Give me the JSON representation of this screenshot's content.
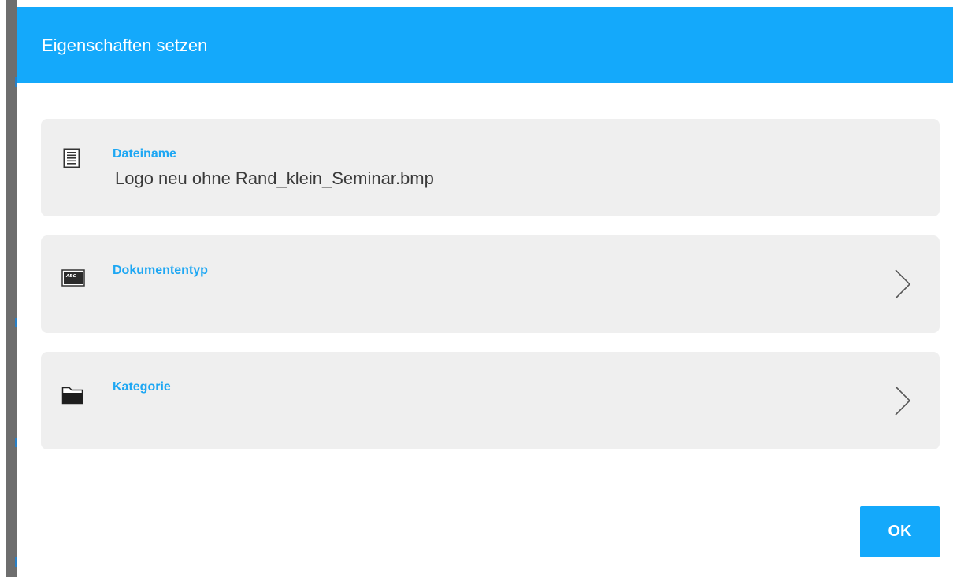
{
  "dialog": {
    "title": "Eigenschaften setzen",
    "accent_color": "#14a9fb",
    "fields": [
      {
        "label": "Dateiname",
        "value": "Logo neu ohne Rand_klein_Seminar.bmp",
        "icon": "document-lines-icon",
        "navigable": false
      },
      {
        "label": "Dokumententyp",
        "value": "",
        "icon": "abc-document-type-icon",
        "icon_text": "ABC",
        "navigable": true
      },
      {
        "label": "Kategorie",
        "value": "",
        "icon": "folder-icon",
        "navigable": true
      }
    ],
    "ok_label": "OK"
  }
}
